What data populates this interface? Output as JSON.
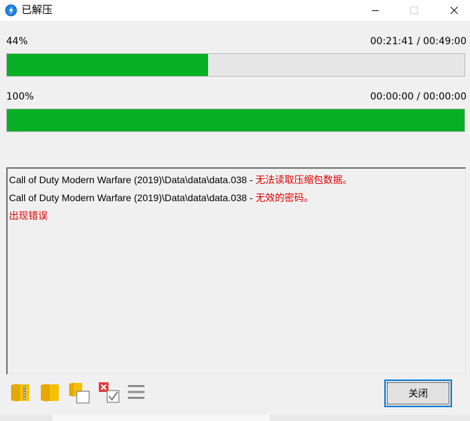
{
  "window": {
    "title": "已解压",
    "app_icon": "lightning-icon",
    "controls": [
      "minimize-icon",
      "maximize-icon",
      "close-icon"
    ]
  },
  "progress": [
    {
      "percent_label": "44%",
      "time": "00:21:41 / 00:49:00",
      "fraction": 0.44
    },
    {
      "percent_label": "100%",
      "time": "00:00:00 / 00:00:00",
      "fraction": 1.0
    }
  ],
  "log": [
    {
      "path": "Call of Duty Modern Warfare (2019)\\Data\\data\\data.038",
      "sep": " - ",
      "error": "无法读取压缩包数据。"
    },
    {
      "path": "Call of Duty Modern Warfare (2019)\\Data\\data\\data.038",
      "sep": " - ",
      "error": "无效的密码。"
    },
    {
      "path": "",
      "sep": "",
      "error": "出现错误"
    }
  ],
  "toolbar": {
    "icons": [
      "open-archive-icon",
      "open-folder-icon",
      "copy-icon",
      "select-delete-icon",
      "menu-icon"
    ],
    "close_label": "关闭"
  },
  "colors": {
    "progress_fill": "#06b025",
    "error_text": "#e00000",
    "focus_border": "#0078d7"
  }
}
